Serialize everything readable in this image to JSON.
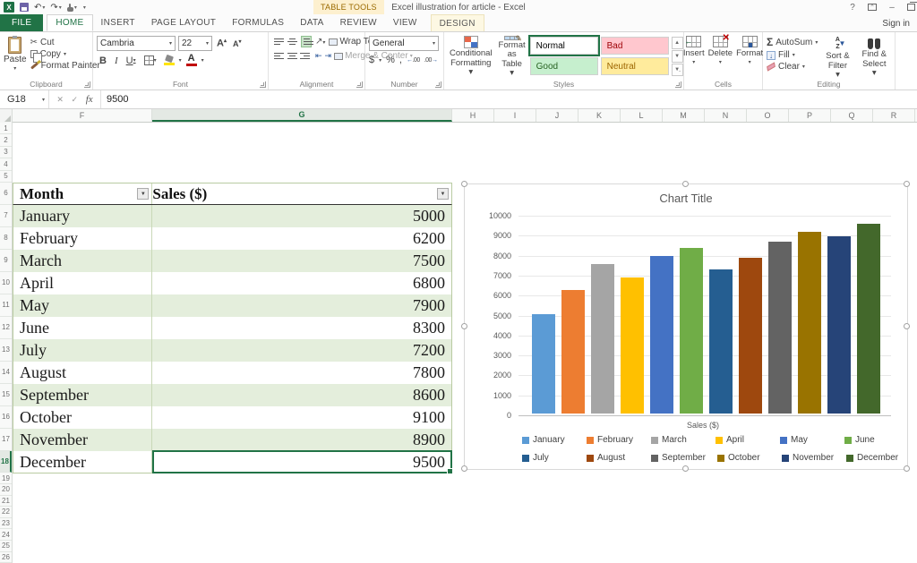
{
  "titlebar": {
    "title": "Excel illustration for article  -  Excel",
    "contextual_tool": "TABLE TOOLS",
    "sign_in": "Sign in",
    "help": "?"
  },
  "tabs": {
    "file": "FILE",
    "items": [
      "HOME",
      "INSERT",
      "PAGE LAYOUT",
      "FORMULAS",
      "DATA",
      "REVIEW",
      "VIEW"
    ],
    "active": "HOME",
    "contextual": "DESIGN"
  },
  "ribbon": {
    "clipboard": {
      "label": "Clipboard",
      "paste": "Paste",
      "cut": "Cut",
      "copy": "Copy",
      "format_painter": "Format Painter"
    },
    "font": {
      "label": "Font",
      "family": "Cambria",
      "size": "22",
      "bold": "B",
      "italic": "I",
      "underline": "U"
    },
    "alignment": {
      "label": "Alignment",
      "wrap_text": "Wrap Text",
      "merge_center": "Merge & Center"
    },
    "number": {
      "label": "Number",
      "format": "General",
      "currency": "$",
      "percent": "%",
      "comma": ","
    },
    "styles": {
      "label": "Styles",
      "conditional_line1": "Conditional",
      "conditional_line2": "Formatting ▾",
      "format_table_line1": "Format as",
      "format_table_line2": "Table ▾",
      "gallery": [
        {
          "name": "Normal",
          "bg": "#FFFFFF",
          "color": "#000000",
          "selected": true
        },
        {
          "name": "Bad",
          "bg": "#FFC7CE",
          "color": "#9C0006",
          "selected": false
        },
        {
          "name": "Good",
          "bg": "#C6EFCE",
          "color": "#276221",
          "selected": false
        },
        {
          "name": "Neutral",
          "bg": "#FFEB9C",
          "color": "#9C6500",
          "selected": false
        }
      ]
    },
    "cells": {
      "label": "Cells",
      "insert": "Insert",
      "delete": "Delete",
      "format": "Format"
    },
    "editing": {
      "label": "Editing",
      "autosum": "AutoSum",
      "fill": "Fill",
      "clear": "Clear",
      "sort_line1": "Sort &",
      "sort_line2": "Filter ▾",
      "find_line1": "Find &",
      "find_line2": "Select ▾"
    }
  },
  "formula_bar": {
    "name_box": "G18",
    "fx": "fx",
    "value": "9500"
  },
  "grid": {
    "columns": [
      "F",
      "G",
      "H",
      "I",
      "J",
      "K",
      "L",
      "M",
      "N",
      "O",
      "P",
      "Q",
      "R"
    ],
    "selected_column": "G",
    "row_start": 1,
    "row_end": 26,
    "active_row": 18
  },
  "table": {
    "headers": [
      "Month",
      "Sales ($)"
    ],
    "rows": [
      [
        "January",
        5000
      ],
      [
        "February",
        6200
      ],
      [
        "March",
        7500
      ],
      [
        "April",
        6800
      ],
      [
        "May",
        7900
      ],
      [
        "June",
        8300
      ],
      [
        "July",
        7200
      ],
      [
        "August",
        7800
      ],
      [
        "September",
        8600
      ],
      [
        "October",
        9100
      ],
      [
        "November",
        8900
      ],
      [
        "December",
        9500
      ]
    ],
    "band_color": "#E4EEDC"
  },
  "chart_data": {
    "type": "bar",
    "title": "Chart Title",
    "categories": [
      "January",
      "February",
      "March",
      "April",
      "May",
      "June",
      "July",
      "August",
      "September",
      "October",
      "November",
      "December"
    ],
    "values": [
      5000,
      6200,
      7500,
      6800,
      7900,
      8300,
      7200,
      7800,
      8600,
      9100,
      8900,
      9500
    ],
    "colors": [
      "#5B9BD5",
      "#ED7D31",
      "#A5A5A5",
      "#FFC000",
      "#4472C4",
      "#70AD47",
      "#255E91",
      "#9E480E",
      "#636363",
      "#997300",
      "#264478",
      "#43682B"
    ],
    "xlabel": "Sales ($)",
    "ylabel": "",
    "ylim": [
      0,
      10000
    ],
    "ytick_step": 1000,
    "grid": true,
    "legend_position": "bottom"
  }
}
